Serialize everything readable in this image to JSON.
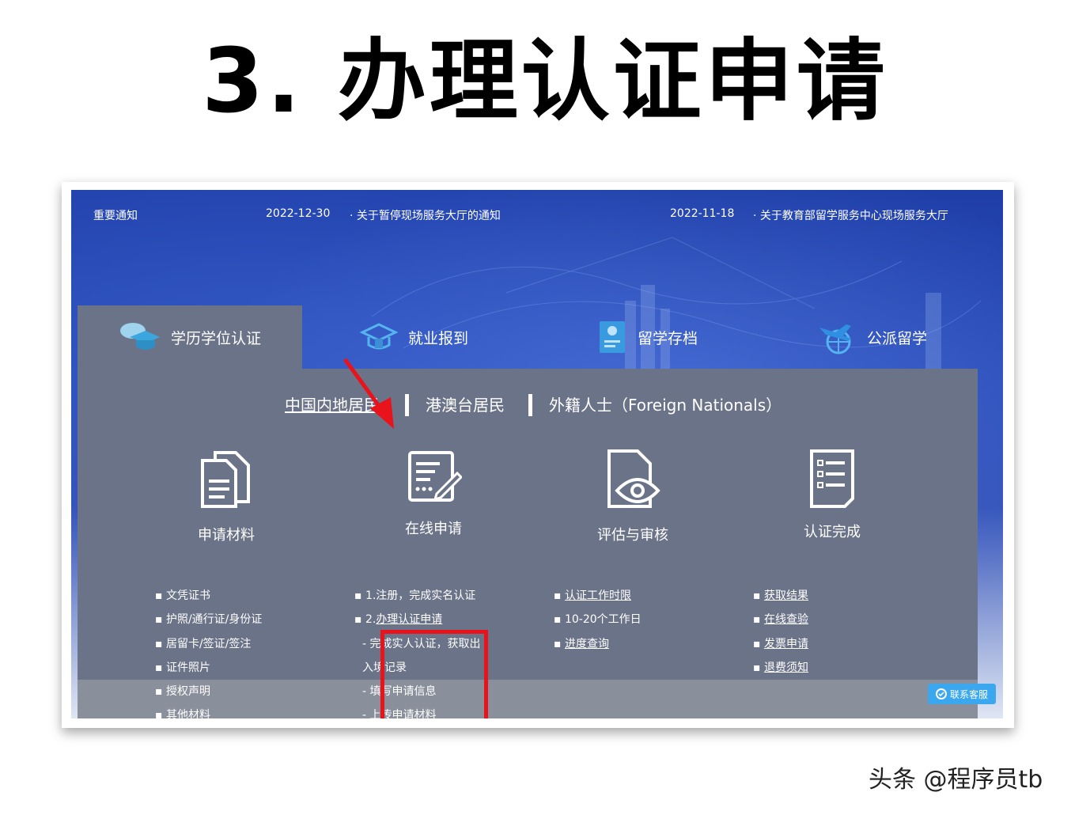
{
  "slide_title": "3. 办理认证申请",
  "notice": {
    "label": "重要通知",
    "items": [
      {
        "date": "2022-12-30",
        "text": "关于暂停现场服务大厅的通知"
      },
      {
        "date": "2022-11-18",
        "text": "关于教育部留学服务中心现场服务大厅"
      }
    ]
  },
  "tabs": [
    {
      "label": "学历学位认证",
      "icon": "graduation-cap-icon",
      "active": true
    },
    {
      "label": "就业报到",
      "icon": "job-report-icon"
    },
    {
      "label": "留学存档",
      "icon": "archive-icon"
    },
    {
      "label": "公派留学",
      "icon": "airplane-globe-icon"
    }
  ],
  "region_tabs": [
    "中国内地居民",
    "港澳台居民",
    "外籍人士（Foreign Nationals）"
  ],
  "steps": [
    {
      "label": "申请材料",
      "icon": "documents-icon",
      "items": [
        "文凭证书",
        "护照/通行证/身份证",
        "居留卡/签证/签注",
        "证件照片",
        "授权声明",
        "其他材料"
      ]
    },
    {
      "label": "在线申请",
      "icon": "online-form-icon",
      "items": [
        "1.注册，完成实名认证",
        "2.",
        "办理认证申请",
        "- 完成实人认证，获取出",
        "入境记录",
        "- 填写申请信息",
        "- 上传申请材料"
      ]
    },
    {
      "label": "评估与审核",
      "icon": "review-eye-icon",
      "items": [
        "认证工作时限",
        "10-20个工作日",
        "进度查询"
      ]
    },
    {
      "label": "认证完成",
      "icon": "checklist-icon",
      "items": [
        "获取结果",
        "在线查验",
        "发票申请",
        "退费须知"
      ]
    }
  ],
  "customer_service": "联系客服",
  "watermark": "头条 @程序员tb",
  "colors": {
    "highlight": "#e8131b",
    "panel": "#6b7389",
    "banner": "#2a4cb8",
    "cs_button": "#3ba7ee"
  }
}
